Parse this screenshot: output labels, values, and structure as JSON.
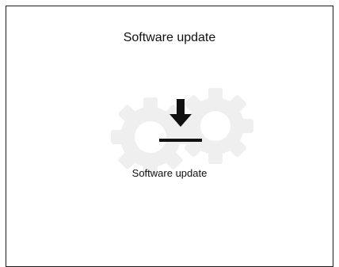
{
  "screen": {
    "title": "Software update",
    "caption": "Software update"
  },
  "icons": {
    "background": "gears-icon",
    "foreground": "download-icon"
  },
  "colors": {
    "text": "#111111",
    "icon": "#111111",
    "gears": "#efefef",
    "background": "#ffffff"
  }
}
